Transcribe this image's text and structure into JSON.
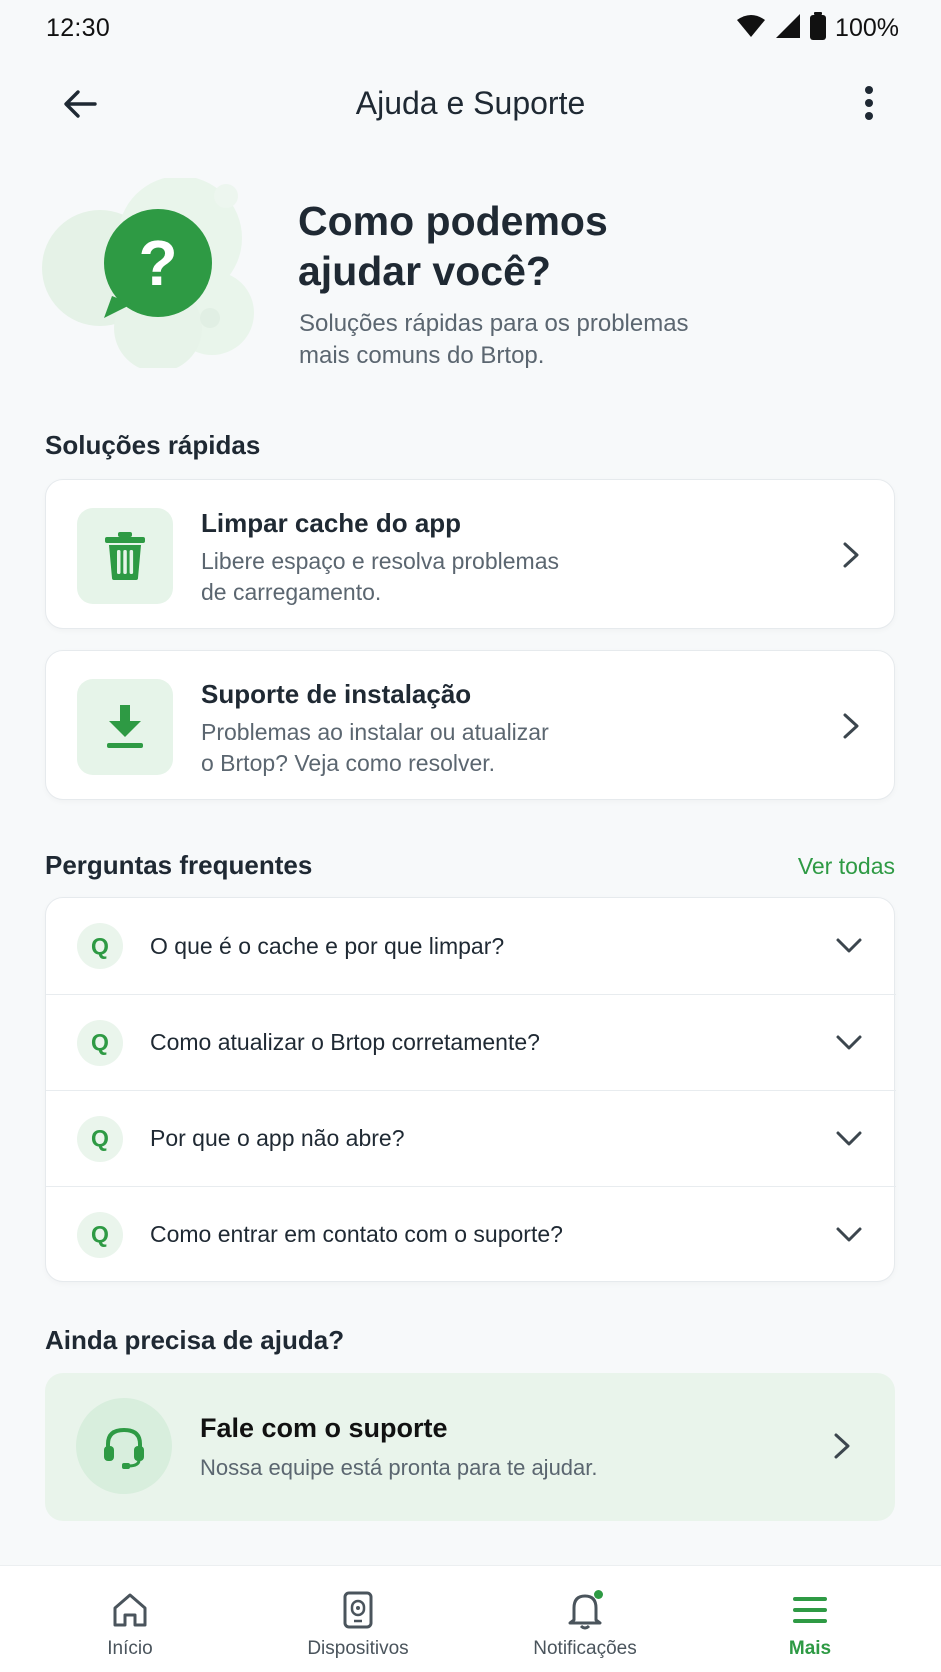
{
  "status_bar": {
    "time": "12:30",
    "battery": "100%"
  },
  "app_bar": {
    "title": "Ajuda e Suporte"
  },
  "hero": {
    "title_line1": "Como podemos",
    "title_line2": "ajudar você?",
    "subtitle_line1": "Soluções rápidas para os problemas",
    "subtitle_line2": "mais comuns do Brtop."
  },
  "quick_solutions": {
    "title": "Soluções rápidas",
    "items": [
      {
        "title": "Limpar cache do app",
        "desc_line1": "Libere espaço e resolva problemas",
        "desc_line2": "de carregamento."
      },
      {
        "title": "Suporte de instalação",
        "desc_line1": "Problemas ao instalar ou atualizar",
        "desc_line2": "o Brtop? Veja como resolver."
      }
    ]
  },
  "faq": {
    "title": "Perguntas frequentes",
    "see_all": "Ver todas",
    "badge": "Q",
    "items": [
      {
        "question": "O que é o cache e por que limpar?"
      },
      {
        "question": "Como atualizar o Brtop corretamente?"
      },
      {
        "question": "Por que o app não abre?"
      },
      {
        "question": "Como entrar em contato com o suporte?"
      }
    ]
  },
  "support": {
    "section_title": "Ainda precisa de ajuda?",
    "title": "Fale com o suporte",
    "desc": "Nossa equipe está pronta para te ajudar."
  },
  "bottom_nav": {
    "items": [
      {
        "label": "Início",
        "icon": "home-icon"
      },
      {
        "label": "Dispositivos",
        "icon": "device-icon"
      },
      {
        "label": "Notificações",
        "icon": "bell-icon",
        "has_badge": true
      },
      {
        "label": "Mais",
        "icon": "menu-icon",
        "active": true
      }
    ]
  },
  "colors": {
    "accent": "#2e9a44",
    "accent_light": "#e6f4e9",
    "background": "#f7f9fa"
  }
}
